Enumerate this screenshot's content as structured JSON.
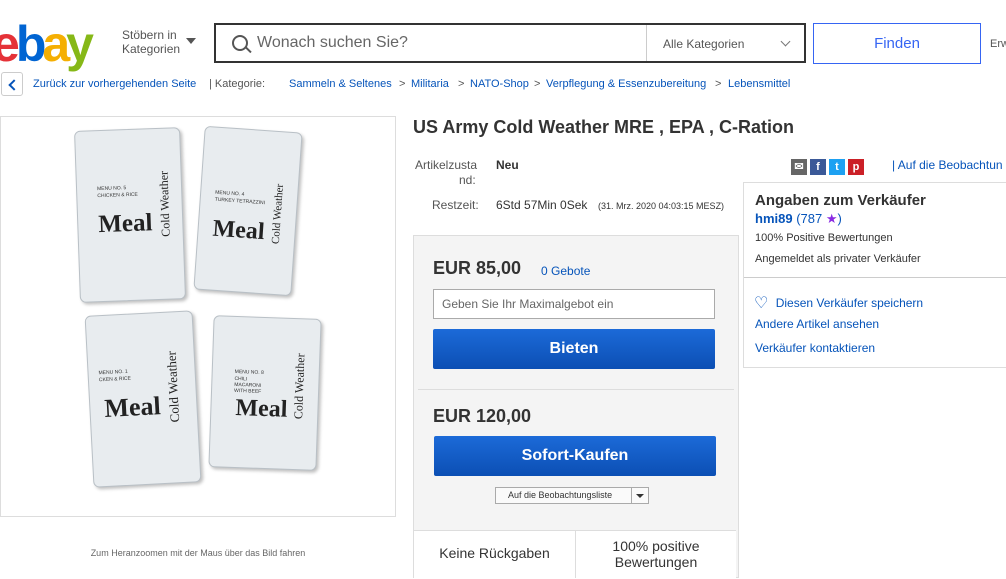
{
  "header": {
    "logo_letters": [
      "e",
      "b",
      "a",
      "y"
    ],
    "logo_colors": [
      "#e53238",
      "#0064d2",
      "#f5af02",
      "#86b817"
    ],
    "browse_label_line1": "Stöbern in",
    "browse_label_line2": "Kategorien",
    "search_placeholder": "Wonach suchen Sie?",
    "category_select": "Alle Kategorien",
    "find_button": "Finden",
    "advanced_cut": "Erw"
  },
  "breadcrumb": {
    "back": "Zurück zur vorhergehenden Seite",
    "category_label": "| Kategorie:",
    "items": [
      "Sammeln & Seltenes",
      "Militaria",
      "NATO-Shop",
      "Verpflegung & Essenzubereitung",
      "Lebensmittel"
    ],
    "separator": ">"
  },
  "image": {
    "zoom_hint": "Zum Heranzoomen mit der Maus über das Bild fahren",
    "packs": [
      {
        "meal": "Meal",
        "cw": "Cold Weather",
        "menu": "MENU NO. 5",
        "dish": "CHICKEN & RICE"
      },
      {
        "meal": "Meal",
        "cw": "Cold Weather",
        "menu": "MENU NO. 4",
        "dish": "TURKEY TETRAZZINI"
      },
      {
        "meal": "Meal",
        "cw": "Cold Weather",
        "menu": "MENU NO. 1",
        "dish": "CKEN & RICE"
      },
      {
        "meal": "Meal",
        "cw": "Cold Weather",
        "menu": "MENU NO. 8",
        "dish": "CHILI MACARONI WITH BEEF"
      }
    ]
  },
  "item": {
    "title": "US Army Cold Weather MRE , EPA , C-Ration",
    "condition_label_1": "Artikelzusta",
    "condition_label_2": "nd:",
    "condition_value": "Neu",
    "time_label": "Restzeit:",
    "time_value": "6Std 57Min 0Sek",
    "time_detail": "(31. Mrz. 2020   04:03:15 MESZ)",
    "watch_link": "| Auf die Beobachtun",
    "share_icons": [
      "email-icon",
      "facebook-icon",
      "twitter-icon",
      "pinterest-icon"
    ]
  },
  "bid": {
    "price": "EUR 85,00",
    "bids_count": "0 Gebote",
    "max_bid_placeholder": "Geben Sie Ihr Maximalgebot ein",
    "bid_button": "Bieten",
    "buy_price": "EUR 120,00",
    "buy_button": "Sofort-Kaufen",
    "watchlist_button": "Auf die Beobachtungsliste",
    "returns": "Keine Rückgaben",
    "positive_1": "100% positive",
    "positive_2": "Bewertungen"
  },
  "seller": {
    "heading": "Angaben zum Verkäufer",
    "name": "hmi89",
    "rating": "(787",
    "rating_end": ")",
    "positive": "100% Positive Bewertungen",
    "type": "Angemeldet als privater Verkäufer",
    "save": "Diesen Verkäufer speichern",
    "other_items": "Andere Artikel ansehen",
    "contact": "Verkäufer kontaktieren"
  }
}
